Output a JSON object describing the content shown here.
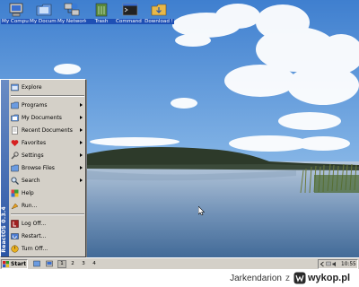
{
  "desktop": {
    "icons": [
      {
        "label": "My Computer",
        "icon": "computer-icon"
      },
      {
        "label": "My Docume...",
        "icon": "documents-folder-icon"
      },
      {
        "label": "My Network...",
        "icon": "network-icon"
      },
      {
        "label": "Trash",
        "icon": "trash-icon"
      },
      {
        "label": "Command Prompt",
        "icon": "terminal-icon"
      },
      {
        "label": "Download !",
        "icon": "download-icon"
      }
    ]
  },
  "start_menu": {
    "banner": "ReactOS 0.3.4",
    "items": [
      {
        "label": "Explore",
        "icon": "explore-icon",
        "submenu": false
      },
      {
        "label": "Programs",
        "icon": "programs-icon",
        "submenu": true
      },
      {
        "label": "My Documents",
        "icon": "my-documents-icon",
        "submenu": true
      },
      {
        "label": "Recent Documents",
        "icon": "recent-documents-icon",
        "submenu": true
      },
      {
        "label": "Favorites",
        "icon": "favorites-icon",
        "submenu": true
      },
      {
        "label": "Settings",
        "icon": "settings-icon",
        "submenu": true
      },
      {
        "label": "Browse Files",
        "icon": "browse-files-icon",
        "submenu": true
      },
      {
        "label": "Search",
        "icon": "search-icon",
        "submenu": true
      },
      {
        "label": "Help",
        "icon": "help-icon",
        "submenu": false
      },
      {
        "label": "Run...",
        "icon": "run-icon",
        "submenu": false
      },
      {
        "label": "Log Off...",
        "icon": "log-off-icon",
        "submenu": false
      },
      {
        "label": "Restart...",
        "icon": "restart-icon",
        "submenu": false
      },
      {
        "label": "Turn Off...",
        "icon": "turn-off-icon",
        "submenu": false
      }
    ]
  },
  "taskbar": {
    "start_label": "Start",
    "workspaces": [
      "1",
      "2",
      "3",
      "4"
    ],
    "clock": "10:55"
  },
  "watermark": {
    "user": "Jarkendarion",
    "separator": "z",
    "site": "wykop.pl"
  },
  "colors": {
    "menu_bg": "#d4d0c8",
    "banner_top": "#6a8cc4",
    "banner_bottom": "#2a55a5",
    "icon_label_bg": "#1e4fb5"
  }
}
